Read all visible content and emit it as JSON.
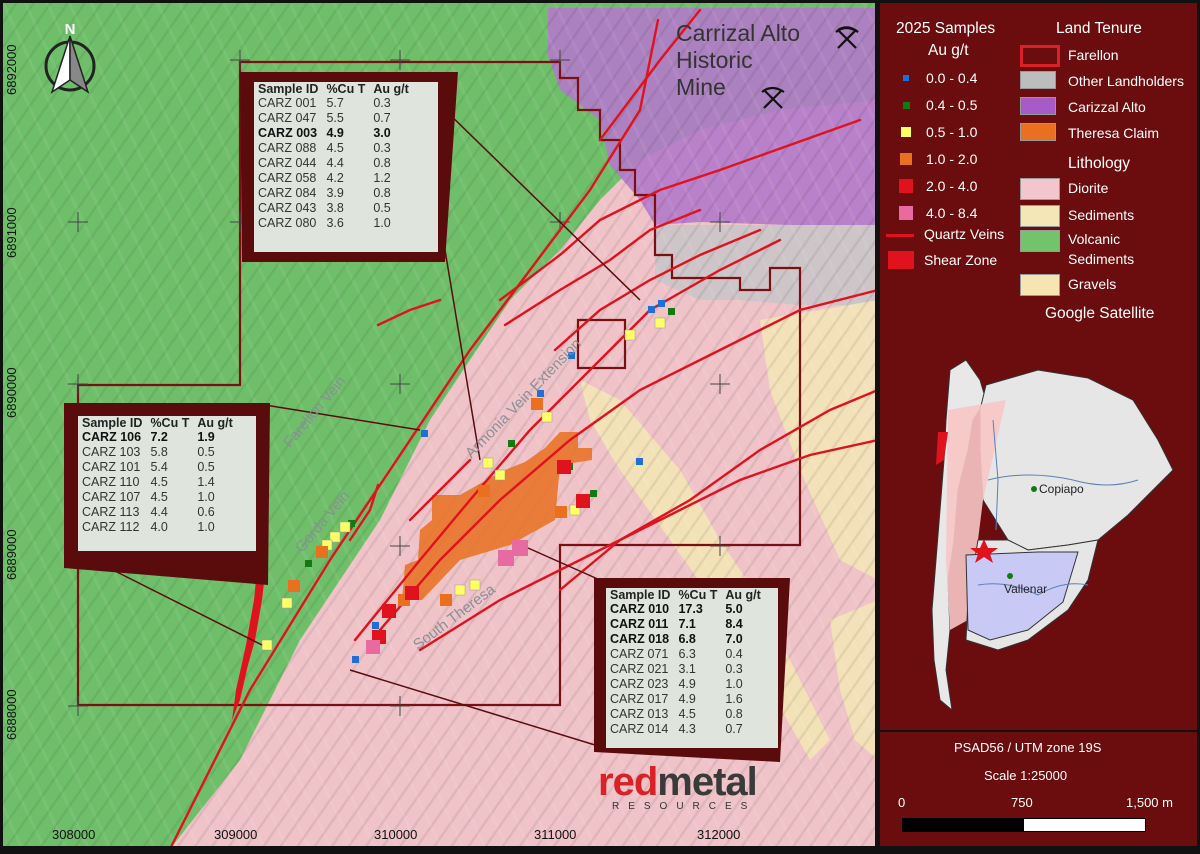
{
  "map": {
    "place_title_1": "Carrizal Alto",
    "place_title_2": "Historic",
    "place_title_3": "Mine",
    "north_label": "N",
    "x_ticks": [
      "308000",
      "309000",
      "310000",
      "311000",
      "312000"
    ],
    "y_ticks": [
      "6892000",
      "6891000",
      "6890000",
      "6889000",
      "6888000"
    ],
    "vein_labels": [
      "Farellon Vein",
      "Gorda Vein",
      "Armonia Vein Extension",
      "South Theresa"
    ],
    "logo_word_1": "red",
    "logo_word_2": "metal",
    "logo_sub": "RESOURCES"
  },
  "tables": [
    {
      "headers": [
        "Sample ID",
        "%Cu T",
        "Au g/t"
      ],
      "rows": [
        [
          "CARZ 001",
          "5.7",
          "0.3",
          false
        ],
        [
          "CARZ 047",
          "5.5",
          "0.7",
          false
        ],
        [
          "CARZ 003",
          "4.9",
          "3.0",
          true
        ],
        [
          "CARZ 088",
          "4.5",
          "0.3",
          false
        ],
        [
          "CARZ 044",
          "4.4",
          "0.8",
          false
        ],
        [
          "CARZ 058",
          "4.2",
          "1.2",
          false
        ],
        [
          "CARZ 084",
          "3.9",
          "0.8",
          false
        ],
        [
          "CARZ 043",
          "3.8",
          "0.5",
          false
        ],
        [
          "CARZ 080",
          "3.6",
          "1.0",
          false
        ]
      ]
    },
    {
      "headers": [
        "Sample ID",
        "%Cu T",
        "Au g/t"
      ],
      "rows": [
        [
          "CARZ 106",
          "7.2",
          "1.9",
          true
        ],
        [
          "CARZ 103",
          "5.8",
          "0.5",
          false
        ],
        [
          "CARZ 101",
          "5.4",
          "0.5",
          false
        ],
        [
          "CARZ 110",
          "4.5",
          "1.4",
          false
        ],
        [
          "CARZ 107",
          "4.5",
          "1.0",
          false
        ],
        [
          "CARZ 113",
          "4.4",
          "0.6",
          false
        ],
        [
          "CARZ 112",
          "4.0",
          "1.0",
          false
        ]
      ]
    },
    {
      "headers": [
        "Sample ID",
        "%Cu T",
        "Au g/t"
      ],
      "rows": [
        [
          "CARZ 010",
          "17.3",
          "5.0",
          true
        ],
        [
          "CARZ 011",
          "7.1",
          "8.4",
          true
        ],
        [
          "CARZ 018",
          "6.8",
          "7.0",
          true
        ],
        [
          "CARZ 071",
          "6.3",
          "0.4",
          false
        ],
        [
          "CARZ 021",
          "3.1",
          "0.3",
          false
        ],
        [
          "CARZ 023",
          "4.9",
          "1.0",
          false
        ],
        [
          "CARZ 017",
          "4.9",
          "1.6",
          false
        ],
        [
          "CARZ 013",
          "4.5",
          "0.8",
          false
        ],
        [
          "CARZ 014",
          "4.3",
          "0.7",
          false
        ]
      ]
    }
  ],
  "legend": {
    "samples_title_1": "2025 Samples",
    "samples_title_2": "Au g/t",
    "sample_classes": [
      {
        "label": "0.0 - 0.4",
        "color": "#1e6fd6"
      },
      {
        "label": "0.4 - 0.5",
        "color": "#137a13"
      },
      {
        "label": "0.5 - 1.0",
        "color": "#ffff66"
      },
      {
        "label": "1.0 - 2.0",
        "color": "#e8701f"
      },
      {
        "label": "2.0 - 4.0",
        "color": "#e0121e"
      },
      {
        "label": "4.0 - 8.4",
        "color": "#e76aa0"
      }
    ],
    "quartz_veins": "Quartz Veins",
    "shear_zone": "Shear Zone",
    "land_tenure_title": "Land Tenure",
    "land_tenure": [
      {
        "label": "Farellon",
        "color": "#6b0c0e"
      },
      {
        "label": "Other Landholders",
        "color": "#bdbdbd"
      },
      {
        "label": "Carizzal Alto",
        "color": "#a65cc6"
      },
      {
        "label": "Theresa Claim",
        "color": "#e8701f"
      }
    ],
    "lithology_title": "Lithology",
    "lithology": [
      {
        "label": "Diorite",
        "color": "#f1c6cc"
      },
      {
        "label": "Sediments",
        "color": "#f3e7b8"
      },
      {
        "label": "Volcanic",
        "color": "#72c36c"
      },
      {
        "label": "Sediments",
        "color": "#72c36c"
      },
      {
        "label": "Gravels",
        "color": "#f6e5b3"
      }
    ],
    "google_satellite": "Google Satellite",
    "inset_cities": [
      "Copiapo",
      "Vallenar"
    ]
  },
  "scale": {
    "crs": "PSAD56 / UTM zone 19S",
    "ratio": "Scale 1:25000",
    "ticks": [
      "0",
      "750",
      "1,500 m"
    ]
  }
}
